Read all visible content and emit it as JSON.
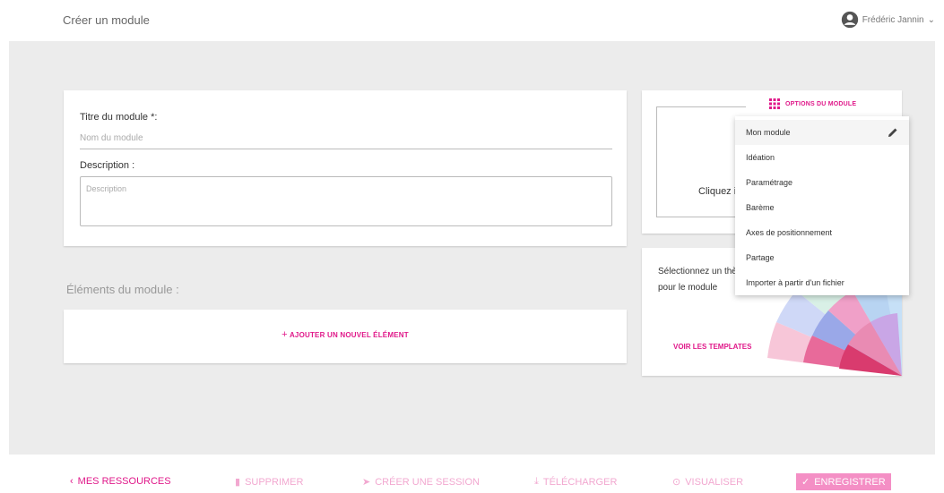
{
  "header": {
    "title": "Créer un module",
    "user_name": "Frédéric Jannin"
  },
  "form": {
    "title_label": "Titre du module *:",
    "title_placeholder": "Nom du module",
    "description_label": "Description :",
    "description_placeholder": "Description"
  },
  "elements": {
    "label": "Éléments du module :",
    "add_button": "AJOUTER UN NOUVEL ÉLÉMENT"
  },
  "upload": {
    "text": "Cliquez i"
  },
  "theme": {
    "text": "Sélectionnez un thème graphique pour le module",
    "button": "VOIR LES TEMPLATES"
  },
  "options": {
    "button": "OPTIONS DU MODULE",
    "items": [
      "Mon module",
      "Idéation",
      "Paramétrage",
      "Barème",
      "Axes de positionnement",
      "Partage",
      "Importer à partir d'un fichier"
    ]
  },
  "footer": {
    "resources": "MES RESSOURCES",
    "delete": "SUPPRIMER",
    "create_session": "CRÉER UNE SESSION",
    "download": "TÉLÉCHARGER",
    "preview": "VISUALISER",
    "save": "ENREGISTRER"
  },
  "colors": {
    "accent": "#e0198a",
    "accent_light": "#f48fc5",
    "background": "#ececec"
  }
}
